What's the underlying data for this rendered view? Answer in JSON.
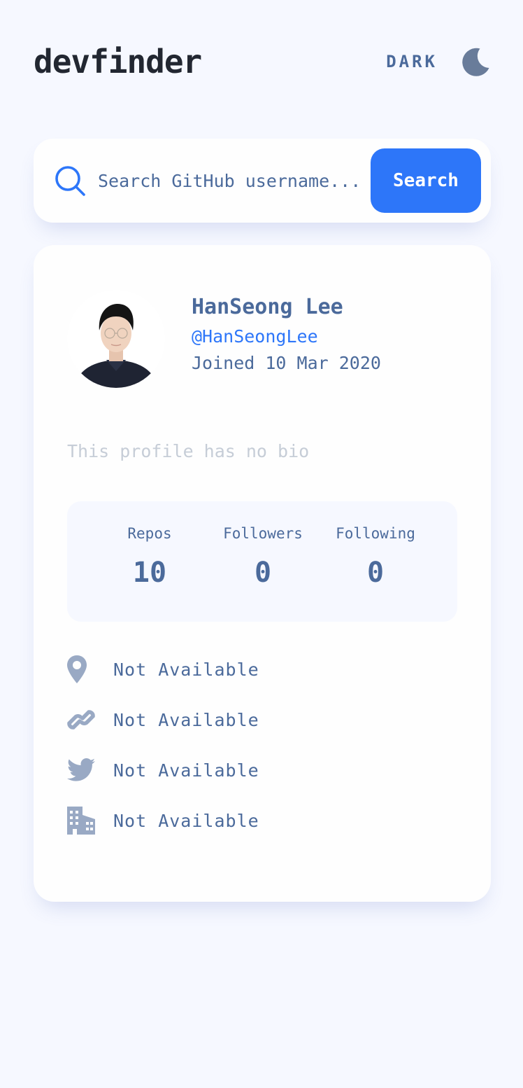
{
  "header": {
    "logo": "devfinder",
    "theme_toggle_label": "DARK",
    "theme_icon": "moon-icon"
  },
  "search": {
    "placeholder": "Search GitHub username...",
    "value": "",
    "button_label": "Search",
    "icon": "search-icon"
  },
  "profile": {
    "name": "HanSeong Lee",
    "login": "@HanSeongLee",
    "joined": "Joined 10 Mar 2020",
    "bio": "This profile has no bio",
    "stats": [
      {
        "label": "Repos",
        "value": "10"
      },
      {
        "label": "Followers",
        "value": "0"
      },
      {
        "label": "Following",
        "value": "0"
      }
    ],
    "links": [
      {
        "icon": "location-icon",
        "text": "Not Available"
      },
      {
        "icon": "link-icon",
        "text": "Not Available"
      },
      {
        "icon": "twitter-icon",
        "text": "Not Available"
      },
      {
        "icon": "company-icon",
        "text": "Not Available"
      }
    ]
  },
  "colors": {
    "background": "#F6F8FF",
    "card": "#FEFEFE",
    "accent": "#2D76F9",
    "text": "#4B6A9B",
    "heading": "#222731",
    "muted": "#C6CDD7",
    "icon": "#99A9C4"
  }
}
